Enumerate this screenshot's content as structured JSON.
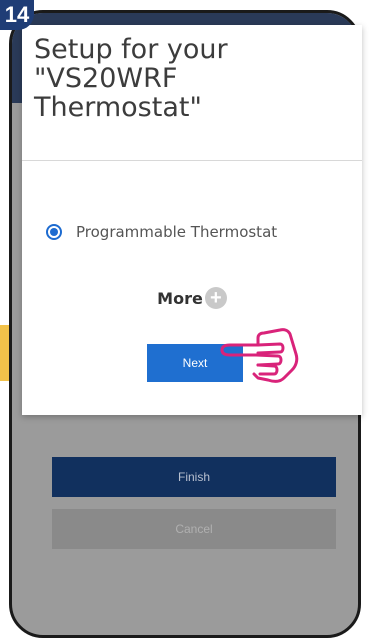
{
  "step": {
    "number": "14"
  },
  "dialog": {
    "title": "Setup for your \"VS20WRF Thermostat\"",
    "option_label": "Programmable Thermostat",
    "more_label": "More",
    "more_icon": "plus-icon",
    "next_label": "Next"
  },
  "background_screen": {
    "finish_label": "Finish",
    "cancel_label": "Cancel"
  },
  "colors": {
    "accent_blue": "#1f6fd0",
    "finish_blue": "#11305e",
    "arrow_yellow": "#f2c24a",
    "hand_pink": "#d9237a",
    "badge_navy": "#1f3d76"
  }
}
